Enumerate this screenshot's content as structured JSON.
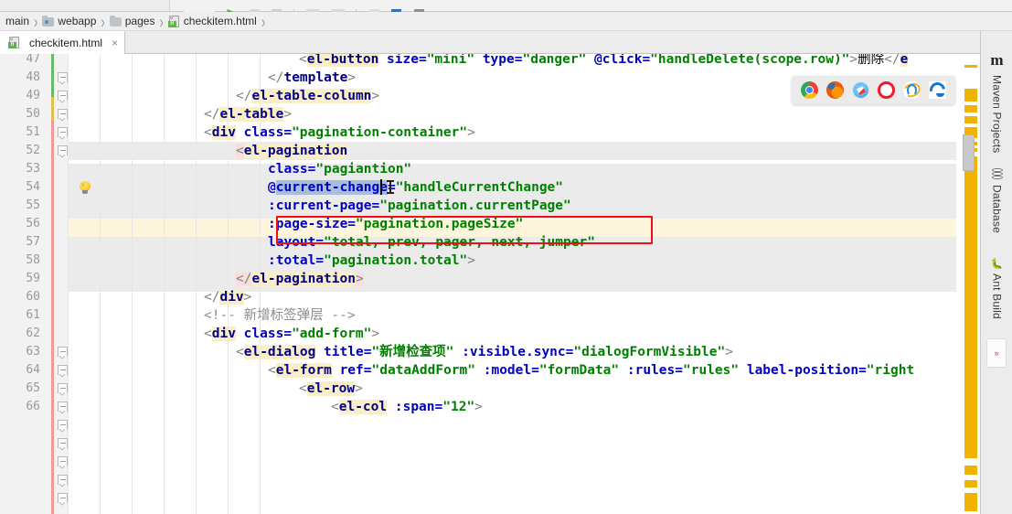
{
  "window": {
    "title": "checkitem.html"
  },
  "toolbar": {
    "icons": [
      "run-icon",
      "debug-icon",
      "stop-icon",
      "build-icon",
      "settings-icon",
      "search-icon"
    ]
  },
  "breadcrumb": {
    "items": [
      {
        "label": "main",
        "icon": "none"
      },
      {
        "label": "webapp",
        "icon": "source-folder-icon"
      },
      {
        "label": "pages",
        "icon": "folder-icon"
      },
      {
        "label": "checkitem.html",
        "icon": "html-file-icon"
      }
    ],
    "separator": "›"
  },
  "editor_tabs": [
    {
      "label": "checkitem.html",
      "icon": "html-file-icon",
      "close": "×",
      "active": true
    }
  ],
  "browser_launcher": {
    "browsers": [
      {
        "name": "chrome-icon",
        "label": "Chrome",
        "color": "#4285F4"
      },
      {
        "name": "firefox-icon",
        "label": "Firefox",
        "color": "#E66000"
      },
      {
        "name": "safari-icon",
        "label": "Safari",
        "color": "#1B8EEA"
      },
      {
        "name": "opera-icon",
        "label": "Opera",
        "color": "#EE1B2E"
      },
      {
        "name": "ie-icon",
        "label": "Internet Explorer",
        "color": "#F6B40F"
      },
      {
        "name": "edge-icon",
        "label": "Edge",
        "color": "#0F78D4"
      }
    ]
  },
  "right_sidebar": {
    "items": [
      {
        "label": "Maven Projects",
        "icon": "maven-icon"
      },
      {
        "label": "Database",
        "icon": "database-icon"
      },
      {
        "label": "Ant Build",
        "icon": "ant-icon"
      }
    ],
    "collapse_arrow": "»"
  },
  "editor": {
    "first_line": 47,
    "caret_line": 54,
    "selection_text": "current-change",
    "intention_icon": "lightbulb-icon",
    "lines": [
      {
        "num": 47,
        "clipped_top": true
      },
      {
        "num": 48
      },
      {
        "num": 49
      },
      {
        "num": 50
      },
      {
        "num": 51
      },
      {
        "num": 52
      },
      {
        "num": 53
      },
      {
        "num": 54
      },
      {
        "num": 55
      },
      {
        "num": 56
      },
      {
        "num": 57
      },
      {
        "num": 58
      },
      {
        "num": 59
      },
      {
        "num": 60
      },
      {
        "num": 61
      },
      {
        "num": 62
      },
      {
        "num": 63
      },
      {
        "num": 64
      },
      {
        "num": 65
      },
      {
        "num": 66,
        "clipped_bottom": true
      }
    ],
    "code_text": {
      "l47": "<el-button size=\"mini\" type=\"danger\" @click=\"handleDelete(scope.row)\">删除</el-button>",
      "l48": "</template>",
      "l49": "</el-table-column>",
      "l50": "</el-table>",
      "l51": "<div class=\"pagination-container\">",
      "l52": "<el-pagination",
      "l53": "class=\"pagiantion\"",
      "l54": "@current-change=\"handleCurrentChange\"",
      "l55": ":current-page=\"pagination.currentPage\"",
      "l56": ":page-size=\"pagination.pageSize\"",
      "l57": "layout=\"total, prev, pager, next, jumper\"",
      "l58": ":total=\"pagination.total\">",
      "l59": "</el-pagination>",
      "l60": "</div>",
      "l61": "<!-- 新增标签弹层 -->",
      "l62": "<div class=\"add-form\">",
      "l63": "<el-dialog title=\"新增检查项\" :visible.sync=\"dialogFormVisible\">",
      "l64": "<el-form ref=\"dataAddForm\" :model=\"formData\" :rules=\"rules\" label-position=\"right",
      "l65": "<el-row>",
      "l66": "<el-col :span=\"12\">"
    }
  },
  "annotation": {
    "type": "red-rectangle",
    "color": "#ee1111",
    "target": "@current-change=\"handleCurrentChange\""
  },
  "colors": {
    "tag": "#000080",
    "attribute": "#0000c0",
    "value": "#008000",
    "comment": "#8c8c8c",
    "caret_line_bg": "#fff9e0",
    "block_bg": "#ebebeb",
    "tag_match_bg": "#faeec8",
    "selection_bg": "#a8bede",
    "warning_stripe": "#f0b400"
  }
}
